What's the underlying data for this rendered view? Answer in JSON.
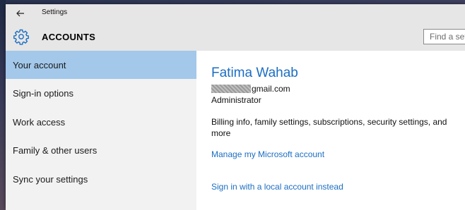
{
  "window": {
    "title": "Settings"
  },
  "header": {
    "section_title": "ACCOUNTS",
    "search_placeholder": "Find a setting"
  },
  "sidebar": {
    "items": [
      {
        "label": "Your account",
        "selected": true
      },
      {
        "label": "Sign-in options",
        "selected": false
      },
      {
        "label": "Work access",
        "selected": false
      },
      {
        "label": "Family & other users",
        "selected": false
      },
      {
        "label": "Sync your settings",
        "selected": false
      }
    ]
  },
  "account": {
    "name": "Fatima Wahab",
    "email_visible": "gmail.com",
    "role": "Administrator",
    "billing_text": "Billing info, family settings, subscriptions, security settings, and more",
    "manage_link": "Manage my Microsoft account",
    "local_link": "Sign in with a local account instead"
  },
  "colors": {
    "accent": "#1b6ec2",
    "selected_bg": "#a3c8ea",
    "sidebar_bg": "#f2f2f2",
    "header_bg": "#e6e6e6"
  },
  "icons": {
    "back": "back-arrow-icon",
    "settings": "gear-icon"
  }
}
